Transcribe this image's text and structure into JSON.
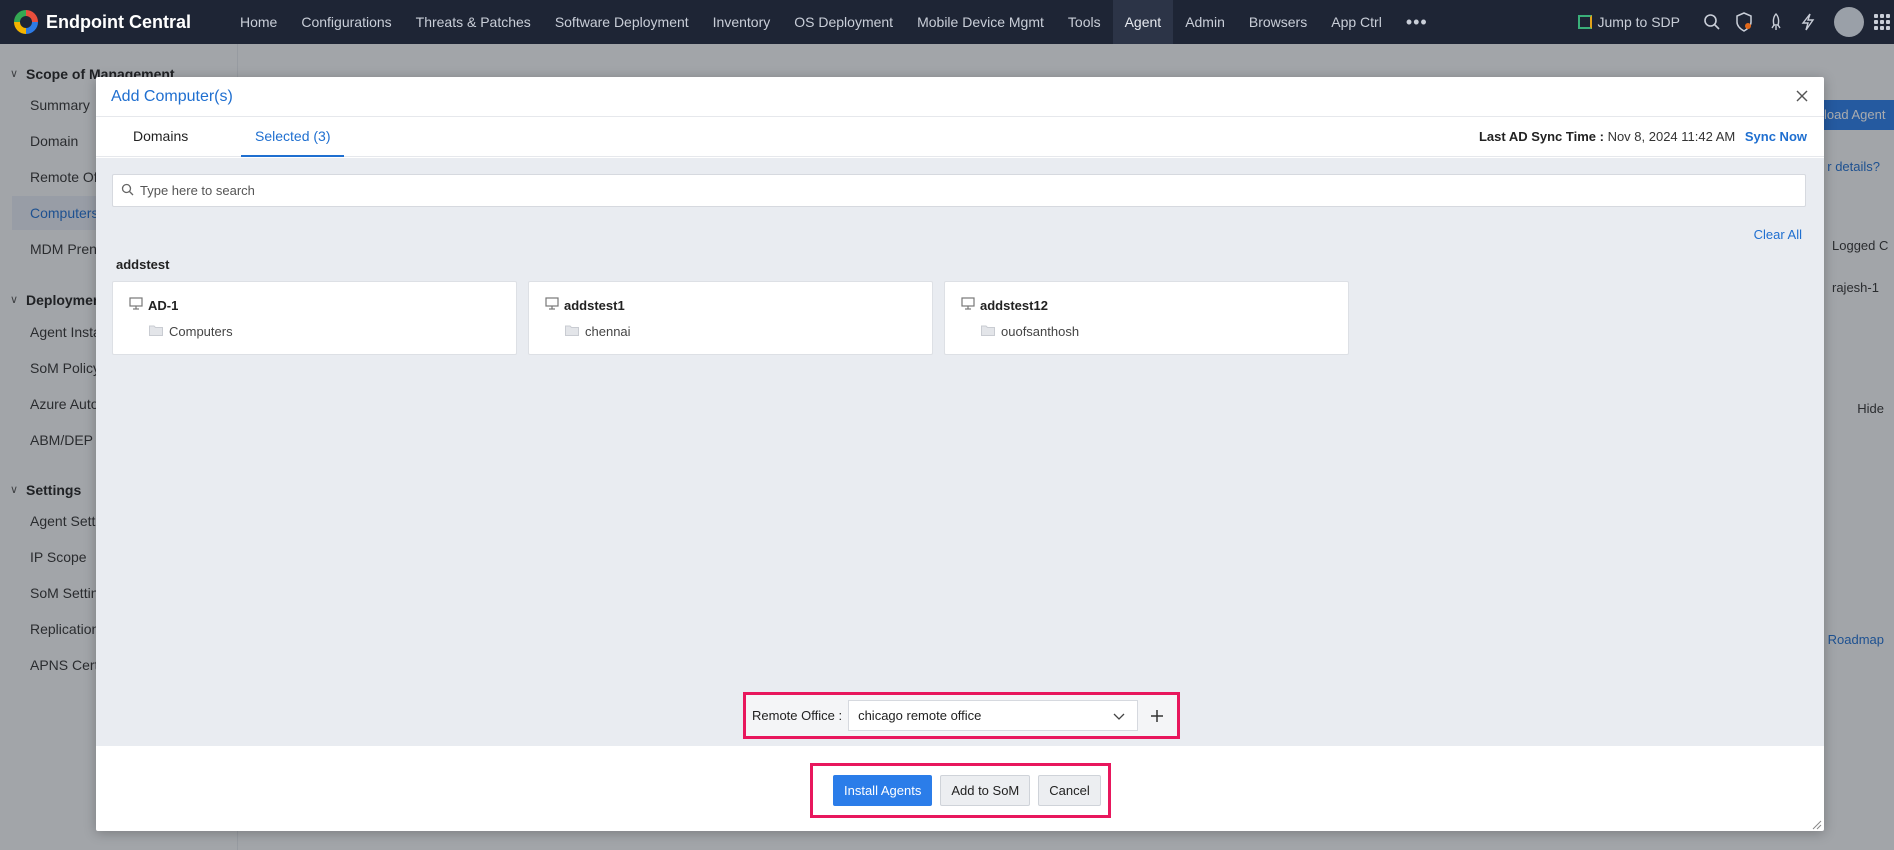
{
  "app": {
    "name": "Endpoint Central",
    "nav": [
      "Home",
      "Configurations",
      "Threats & Patches",
      "Software Deployment",
      "Inventory",
      "OS Deployment",
      "Mobile Device Mgmt",
      "Tools",
      "Agent",
      "Admin",
      "Browsers",
      "App Ctrl"
    ],
    "active_nav": "Agent",
    "more": "•••",
    "jump_label": "Jump to SDP"
  },
  "sidebar": {
    "sections": [
      {
        "title": "Scope of Management",
        "items": [
          "Summary",
          "Domain",
          "Remote Of",
          "Computers",
          "MDM Pren"
        ]
      },
      {
        "title": "Deploymen",
        "items": [
          "Agent Insta",
          "SoM Policy",
          "Azure Auto",
          "ABM/DEP"
        ]
      },
      {
        "title": "Settings",
        "items": [
          "Agent Sett",
          "IP Scope",
          "SoM Settin",
          "Replication",
          "APNS Cert"
        ]
      }
    ],
    "active_item": "Computers"
  },
  "background": {
    "download_btn": "load Agent",
    "details_link": "r details?",
    "col_header": "Logged C",
    "cell_user": "rajesh-1",
    "hide_label": "Hide",
    "roadmap": "Roadmap"
  },
  "modal": {
    "title": "Add Computer(s)",
    "tabs": [
      "Domains",
      "Selected (3)"
    ],
    "active_tab": "Selected (3)",
    "sync_label": "Last AD Sync Time :",
    "sync_value": "Nov 8, 2024 11:42 AM",
    "sync_now": "Sync Now",
    "search_placeholder": "Type here to search",
    "clear_all": "Clear All",
    "group": "addstest",
    "computers": [
      {
        "name": "AD-1",
        "ou": "Computers"
      },
      {
        "name": "addstest1",
        "ou": "chennai"
      },
      {
        "name": "addstest12",
        "ou": "ouofsanthosh"
      }
    ],
    "remote_office_label": "Remote Office :",
    "remote_office_value": "chicago remote office",
    "buttons": {
      "install": "Install Agents",
      "add_som": "Add to SoM",
      "cancel": "Cancel"
    }
  },
  "colors": {
    "accent": "#1f6fd0",
    "primary_button": "#2b7de9",
    "highlight": "#e8175d",
    "topbar": "#1e2535"
  }
}
